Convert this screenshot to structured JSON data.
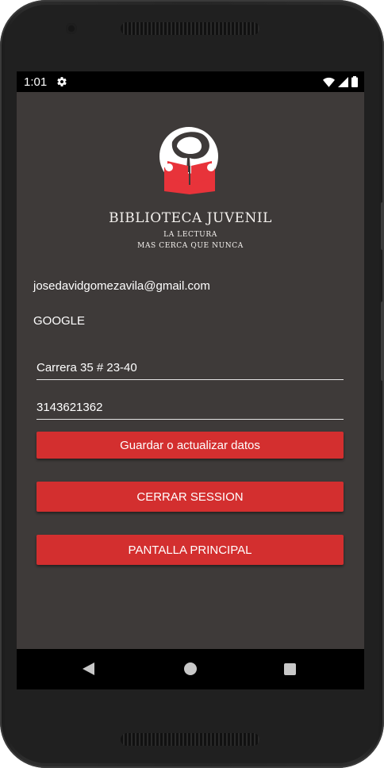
{
  "status_bar": {
    "time": "1:01"
  },
  "brand": {
    "title": "BIBLIOTECA JUVENIL",
    "subtitle_line1": "LA LECTURA",
    "subtitle_line2": "MAS CERCA QUE NUNCA",
    "logo_colors": {
      "book": "#e8333a",
      "figure": "#ffffff"
    }
  },
  "profile": {
    "email": "josedavidgomezavila@gmail.com",
    "provider": "GOOGLE"
  },
  "form": {
    "address_value": "Carrera 35 # 23-40",
    "phone_value": "3143621362"
  },
  "buttons": {
    "save_label": "Guardar o actualizar datos",
    "logout_label": "CERRAR SESSION",
    "main_screen_label": "PANTALLA PRINCIPAL"
  },
  "theme": {
    "background": "#3e3a39",
    "accent": "#d32f2f"
  },
  "icons": {
    "status_left": "gear-icon",
    "status_right": [
      "wifi-icon",
      "signal-icon",
      "battery-icon"
    ],
    "navigation": [
      "back-icon",
      "home-icon",
      "recents-icon"
    ]
  }
}
